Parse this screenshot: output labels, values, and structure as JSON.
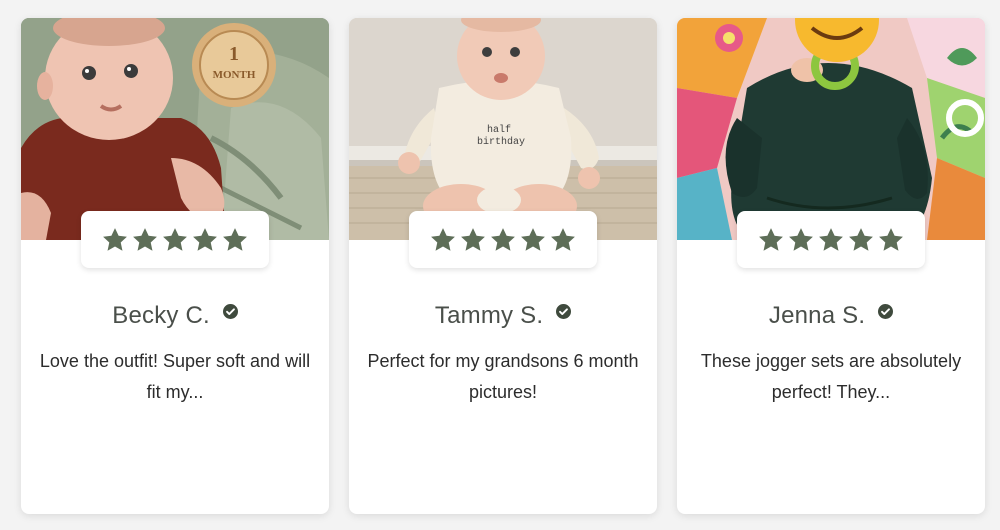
{
  "colors": {
    "star": "#5e6e58",
    "verified": "#3f4a3d",
    "name": "#4a4f4a",
    "text": "#2c2c2c"
  },
  "reviews": [
    {
      "name": "Becky C.",
      "text": "Love the outfit! Super soft and will fit my...",
      "rating": 5,
      "photo_icon": "baby-photo-icon",
      "badge_text_line1": "1",
      "badge_text_line2": "MONTH"
    },
    {
      "name": "Tammy S.",
      "text": "Perfect for my grandsons 6 month pictures!",
      "rating": 5,
      "photo_icon": "baby-photo-icon",
      "shirt_text_line1": "half",
      "shirt_text_line2": "birthday"
    },
    {
      "name": "Jenna S.",
      "text": "These jogger sets are absolutely perfect! They...",
      "rating": 5,
      "photo_icon": "baby-photo-icon"
    }
  ]
}
